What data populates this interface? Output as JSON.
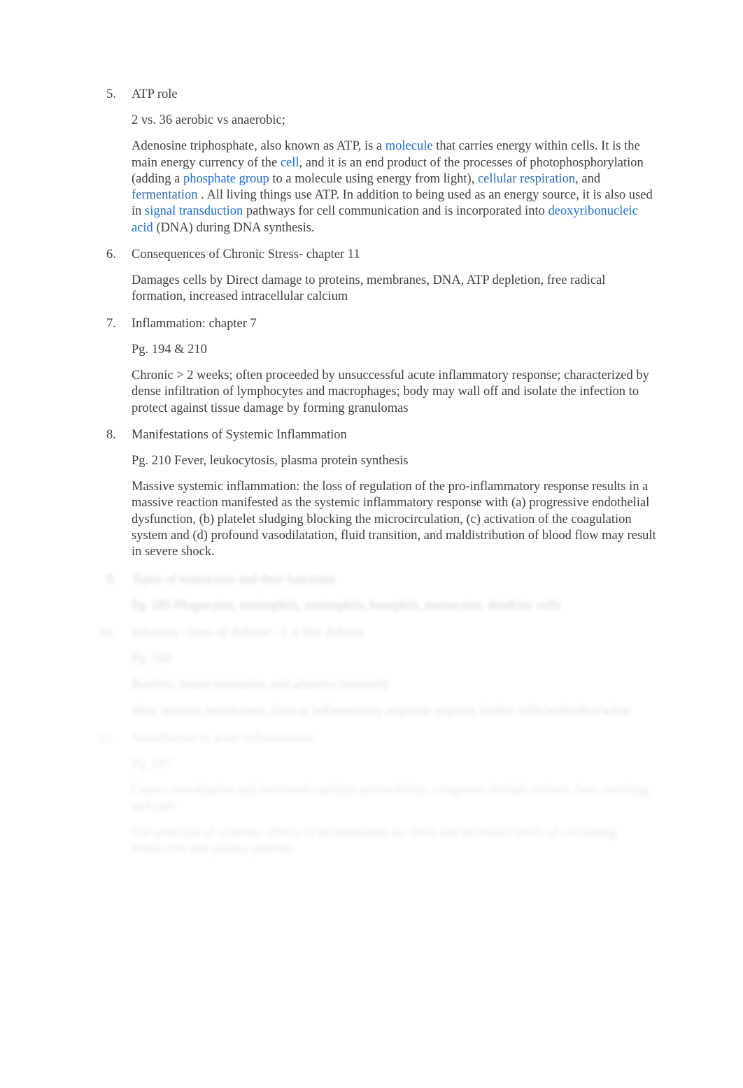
{
  "document": {
    "background_color": "#ffffff",
    "text_color": "#404040",
    "link_color": "#1a6fd4",
    "link_color_muted": "#2f6cb0"
  },
  "items": [
    {
      "number": "5.",
      "title": "ATP role",
      "paragraphs": [
        {
          "id": "p5a",
          "text": "2 vs. 36 aerobic vs anaerobic;"
        }
      ]
    },
    {
      "number": "6.",
      "title": "Consequences of Chronic Stress- chapter 11",
      "paragraphs": [
        {
          "id": "p6a",
          "text": "Damages cells by Direct damage to proteins, membranes, DNA, ATP depletion, free radical formation, increased intracellular calcium"
        }
      ]
    },
    {
      "number": "7.",
      "title": "Inflammation: chapter 7",
      "paragraphs": [
        {
          "id": "p7a",
          "text": "Pg. 194 & 210"
        },
        {
          "id": "p7b",
          "text": "Chronic > 2 weeks; often proceeded by unsuccessful acute inflammatory response; characterized by dense infiltration of lymphocytes and macrophages; body may wall off and isolate the infection to protect against tissue damage by forming granulomas"
        }
      ]
    },
    {
      "number": "8.",
      "title": "Manifestations of Systemic Inflammation",
      "paragraphs": [
        {
          "id": "p8a",
          "text": "Pg. 210 Fever, leukocytosis, plasma protein synthesis"
        },
        {
          "id": "p8b",
          "text": "Massive systemic inflammation: the loss of regulation of the pro-inflammatory response results in a massive reaction manifested as the systemic inflammatory response with (a) progressive endothelial dysfunction, (b) platelet sludging blocking the microcirculation, (c) activation of the coagulation system and (d) profound vasodilatation, fluid transition, and maldistribution of blood flow may result in severe shock."
        }
      ]
    }
  ],
  "atp_paragraph": {
    "seg1": "Adenosine triphosphate, also known as ATP, is a",
    "link1": "molecule",
    "seg2": "that carries energy within cells. It is the main energy currency of the",
    "link2": "cell",
    "seg3": ", and it is an end product of the processes of photophosphorylation (adding a",
    "link3": "phosphate group",
    "seg4": "to a molecule using energy from light),",
    "link4": "cellular respiration",
    "seg5": ", and",
    "link5": "fermentation",
    "seg6": ". All living things use ATP. In addition to being used as an energy source, it is also used in",
    "link6": "signal transduction",
    "seg7": "pathways for cell communication and is incorporated into",
    "link7": "deoxyribonucleic acid",
    "seg8": "(DNA) during DNA synthesis."
  },
  "faded_items": [
    {
      "number": "9.",
      "title": "Types of leukocytes and their functions",
      "blur_level": "faded",
      "paragraphs": [
        {
          "id": "p9a",
          "text": "Pg. 185 Phagocytes, neutrophils, eosinophils, basophils, monocytes, dendritic cells"
        }
      ]
    },
    {
      "number": "10.",
      "title": "Infection - lines of defense - 1 st line defense",
      "blur_level": "faded-2",
      "paragraphs": [
        {
          "id": "p10a",
          "text": "Pg. 160"
        },
        {
          "id": "p10b",
          "text": "Barriers, innate immunity, and adaptive immunity"
        },
        {
          "id": "p10c",
          "text": "Skin, mucous membranes, First or inflammatory response requires further cells/antibodies/white"
        }
      ]
    },
    {
      "number": "11.",
      "title": "Vasodilation in acute inflammation",
      "blur_level": "faded-3",
      "paragraphs": [
        {
          "id": "p11a",
          "text": "Pg. 197"
        },
        {
          "id": "p11b",
          "text": "Causes vasodilation and increased capillary permeability; symptoms include redness, heat, swelling, and pain"
        },
        {
          "id": "p11c",
          "text": "The principal of systemic effects of inflammation are fever and increased levels of circulating leukocytes and plasma proteins"
        }
      ]
    }
  ]
}
